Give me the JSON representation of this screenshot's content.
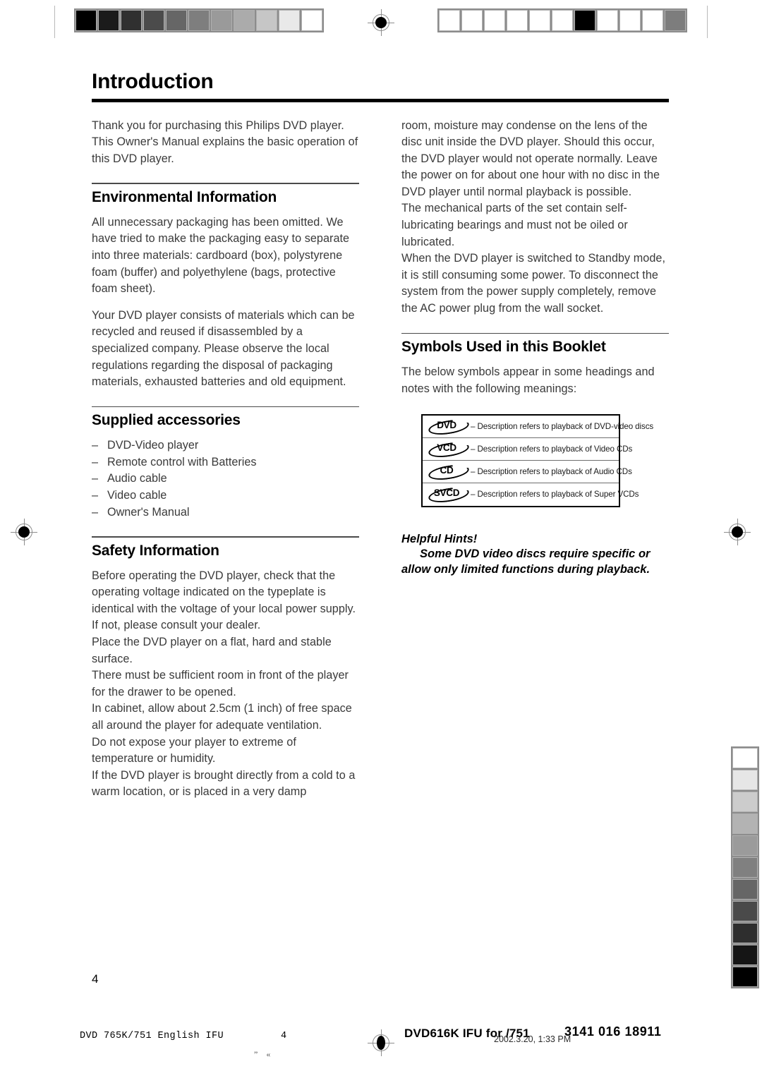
{
  "page": {
    "title": "Introduction",
    "folio": "4"
  },
  "left_column": {
    "intro_paragraph": "Thank you for purchasing this Philips DVD player. This Owner's Manual explains the basic operation of this DVD player.",
    "environmental": {
      "heading": "Environmental Information",
      "paragraph_1": "All unnecessary packaging has been omitted. We have tried to make the packaging easy to separate into three materials: cardboard (box), polystyrene foam (buffer) and polyethylene (bags, protective foam sheet).",
      "paragraph_2": "Your DVD player consists of materials which can be recycled and reused if disassembled by a specialized company. Please observe the local regulations regarding the disposal of packaging materials, exhausted batteries and old equipment."
    },
    "supplied": {
      "heading": "Supplied accessories",
      "dash": "–",
      "items": [
        "DVD-Video player",
        "Remote control with Batteries",
        "Audio cable",
        "Video cable",
        "Owner's Manual"
      ]
    },
    "safety": {
      "heading": "Safety Information",
      "paragraph_1": "Before operating the DVD player, check that the operating voltage indicated on the typeplate is identical with the voltage of your local power supply. If not, please consult your dealer.",
      "paragraph_2": "Place the DVD player on a flat, hard and stable surface.",
      "paragraph_3": "There must be sufficient room in front of the player for the drawer to be opened.",
      "paragraph_4": "In cabinet, allow about 2.5cm (1 inch) of free space all around the player for adequate ventilation.",
      "paragraph_5": "Do not expose your player to extreme of temperature or humidity.",
      "paragraph_6": "If the DVD player is brought directly from a cold to a warm location, or is placed in a very damp"
    }
  },
  "right_column": {
    "continued_text": {
      "paragraph_1": "room, moisture may condense on the lens of the disc unit inside the DVD player. Should this occur, the DVD player would not operate normally. Leave the power on for about one hour with no disc in the DVD player until normal playback is possible.",
      "paragraph_2": "The mechanical parts of the set contain self-lubricating bearings and must not be oiled or lubricated.",
      "paragraph_3": "When the DVD player is switched to Standby mode, it is still consuming some power. To disconnect the system from the power supply completely, remove the AC power plug from the wall socket."
    },
    "symbols": {
      "heading": "Symbols Used in this Booklet",
      "intro": "The below symbols appear in some headings and notes with the following meanings:",
      "rows": [
        {
          "label": "DVD",
          "description": "– Description refers to playback of DVD-video discs"
        },
        {
          "label": "VCD",
          "description": "– Description refers to playback of Video CDs"
        },
        {
          "label": "CD",
          "description": "– Description refers to playback of Audio CDs"
        },
        {
          "label": "SVCD",
          "description": "– Description refers to playback of Super VCDs"
        }
      ]
    },
    "helpful_hints": {
      "heading": "Helpful Hints!",
      "body": "Some DVD video discs require specific or allow only limited functions during playback."
    }
  },
  "footer": {
    "left": "DVD 765K/751 English IFU",
    "page_number": "4",
    "quote_marks": "”«",
    "document": "DVD616K IFU for /751",
    "timestamp": "2002.3.20, 1:33 PM",
    "code": "3141 016 18911"
  },
  "print_marks": {
    "grayscale_top_left": [
      "#000000",
      "#1b1b1b",
      "#303030",
      "#4b4b4b",
      "#666666",
      "#7e7e7e",
      "#9a9a9a",
      "#ababab",
      "#c6c6c6",
      "#e9e9e9",
      "#ffffff"
    ],
    "grayscale_top_right": [
      "#ffffff",
      "#ffffff",
      "#ffffff",
      "#ffffff",
      "#ffffff",
      "#ffffff",
      "#000000",
      "#ffffff",
      "#ffffff",
      "#ffffff",
      "#7d7d7d"
    ],
    "grayscale_right_edge": [
      "#ffffff",
      "#e6e6e6",
      "#cccccc",
      "#b3b3b3",
      "#9b9b9b",
      "#808080",
      "#666666",
      "#4a4a4a",
      "#2e2e2e",
      "#151515",
      "#000000"
    ]
  }
}
